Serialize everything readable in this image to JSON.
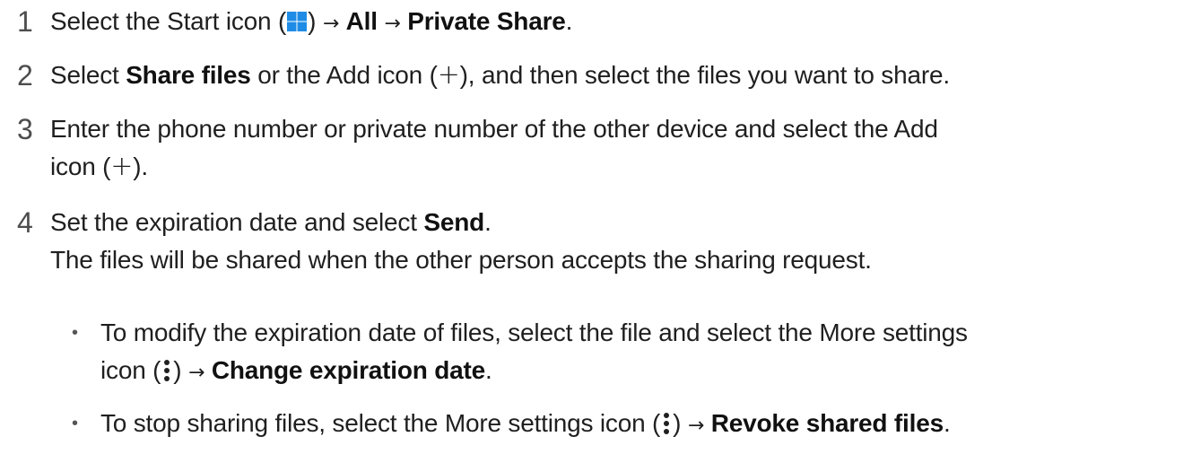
{
  "steps": [
    {
      "number": "1",
      "pre": "Select the Start icon (",
      "after_icon": ") ",
      "b1": "All",
      "b2": "Private Share",
      "end": "."
    },
    {
      "number": "2",
      "pre": "Select ",
      "b1": "Share files",
      "mid": " or the Add icon (",
      "end": "), and then select the files you want to share."
    },
    {
      "number": "3",
      "line1": "Enter the phone number or private number of the other device and select the Add",
      "line2_pre": "icon (",
      "line2_end": ")."
    },
    {
      "number": "4",
      "pre": "Set the expiration date and select ",
      "b1": "Send",
      "end": ".",
      "note": "The files will be shared when the other person accepts the sharing request."
    }
  ],
  "bullets": [
    {
      "bullet": "•",
      "line1": "To modify the expiration date of files, select the file and select the More settings",
      "line2_pre": "icon (",
      "line2_mid": ") ",
      "b1": "Change expiration date",
      "end": "."
    },
    {
      "bullet": "•",
      "pre": "To stop sharing files, select the More settings icon (",
      "mid": ") ",
      "b1": "Revoke shared files",
      "end": "."
    }
  ],
  "arrow_glyph": "→",
  "plus_glyph": "+",
  "colors": {
    "start_icon_blue": "#1e8ce6",
    "text": "#1f1f1f",
    "number": "#4d4d4d"
  }
}
